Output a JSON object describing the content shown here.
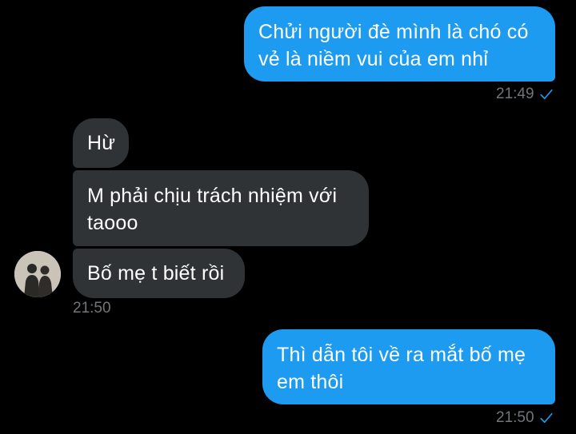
{
  "colors": {
    "background": "#000000",
    "outgoing_bubble": "#1d9bf0",
    "incoming_bubble": "#2f3336",
    "timestamp": "#71767b",
    "check": "#1d9bf0"
  },
  "messages": [
    {
      "direction": "outgoing",
      "text": "Chửi người đè mình là chó có\nvẻ là niềm vui của em nhỉ"
    },
    {
      "direction": "incoming",
      "text": "Hừ"
    },
    {
      "direction": "incoming",
      "text": "M phải chịu trách nhiệm với\ntaooo"
    },
    {
      "direction": "incoming",
      "text": "Bố mẹ t biết rồi"
    },
    {
      "direction": "outgoing",
      "text": "Thì dẫn tôi về ra mắt bố mẹ\nem thôi"
    }
  ],
  "timestamps": {
    "outgoing_1": "21:49",
    "incoming_group": "21:50",
    "outgoing_2": "21:50"
  },
  "icons": {
    "sent_status": "checkmark-icon",
    "avatar": "avatar-photo"
  }
}
